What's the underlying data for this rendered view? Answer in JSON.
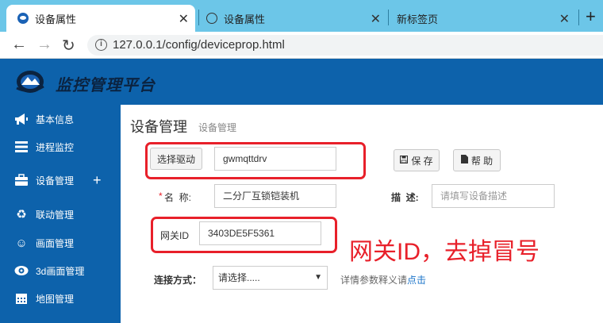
{
  "browser": {
    "tabs": [
      {
        "title": "设备属性",
        "active": true
      },
      {
        "title": "设备属性",
        "active": false
      },
      {
        "title": "新标签页",
        "active": false
      }
    ],
    "close_glyph": "✕",
    "new_tab_glyph": "+",
    "nav": {
      "back": "←",
      "forward": "→",
      "reload": "↻",
      "info": "i"
    },
    "url": "127.0.0.1/config/deviceprop.html"
  },
  "app": {
    "title": "监控管理平台"
  },
  "sidebar": {
    "items": [
      {
        "label": "基本信息",
        "icon": "megaphone-icon",
        "glyph": "📢"
      },
      {
        "label": "进程监控",
        "icon": "list-icon",
        "glyph": "☰"
      },
      {
        "label": "设备管理",
        "icon": "briefcase-icon",
        "glyph": "💼",
        "expand": "+"
      },
      {
        "label": "联动管理",
        "icon": "recycle-icon",
        "glyph": "♻"
      },
      {
        "label": "画面管理",
        "icon": "smiley-icon",
        "glyph": "☺"
      },
      {
        "label": "3d画面管理",
        "icon": "eye-icon",
        "glyph": "◉"
      },
      {
        "label": "地图管理",
        "icon": "calendar-icon",
        "glyph": "▦"
      }
    ]
  },
  "main": {
    "page_title": "设备管理",
    "page_subtitle": "设备管理",
    "select_driver_button": "选择驱动",
    "driver_value": "gwmqttdrv",
    "save_button": "保 存",
    "help_button": "帮 助",
    "name_required_mark": "*",
    "name_label": "名  称:",
    "name_value": "二分厂互锁铠装机",
    "desc_label": "描  述:",
    "desc_placeholder": "请填写设备描述",
    "gateway_label": "网关ID",
    "gateway_value": "3403DE5F5361",
    "annotation": "网关ID，去掉冒号",
    "connect_label": "连接方式：",
    "connect_value": "请选择.....",
    "detail_text": "详情参数释义请",
    "detail_link": "点击"
  },
  "colors": {
    "tabstrip": "#6cc6e8",
    "primary_blue": "#0d62ab",
    "annotation_red": "#e8202a",
    "link_blue": "#1a73c9"
  }
}
